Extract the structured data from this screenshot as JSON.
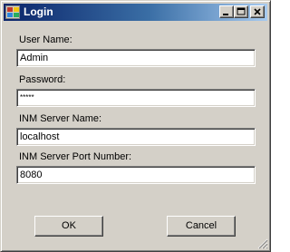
{
  "window": {
    "title": "Login",
    "icon": "app-window-icon",
    "controls": {
      "minimize_icon": "minimize-icon",
      "maximize_icon": "maximize-icon",
      "close_icon": "close-icon"
    }
  },
  "form": {
    "fields": [
      {
        "label": "User Name:",
        "value": "Admin"
      },
      {
        "label": "Password:",
        "value": "*****"
      },
      {
        "label": "INM Server Name:",
        "value": "localhost"
      },
      {
        "label": "INM Server Port Number:",
        "value": "8080"
      }
    ]
  },
  "buttons": {
    "ok_label": "OK",
    "cancel_label": "Cancel"
  },
  "colors": {
    "window_face": "#d4d0c8",
    "titlebar_active_start": "#0a246a",
    "titlebar_active_end": "#a6caf0",
    "title_text": "#ffffff"
  }
}
